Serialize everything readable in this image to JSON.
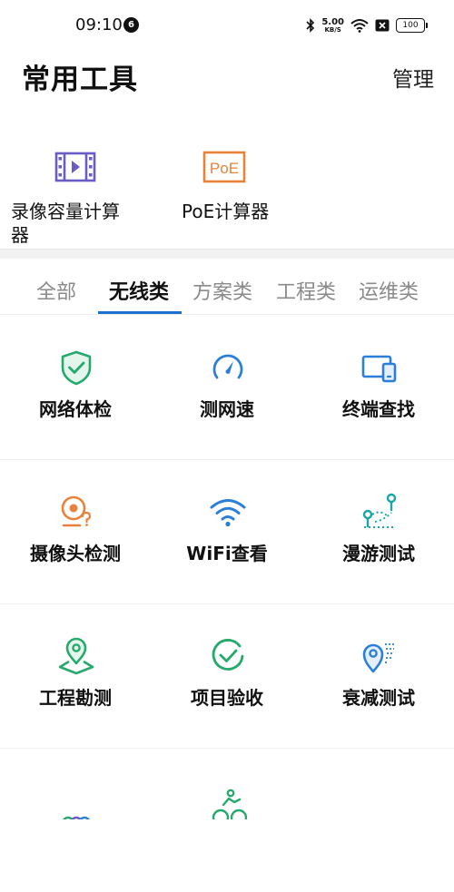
{
  "status_bar": {
    "time": "09:10",
    "notification_count": "6",
    "net_speed_value": "5.00",
    "net_speed_unit": "KB/S",
    "battery": "100"
  },
  "header": {
    "title": "常用工具",
    "manage_label": "管理"
  },
  "common_tools": [
    {
      "label": "录像容量计算器",
      "icon": "video-film-icon",
      "color": "#6b5bc4"
    },
    {
      "label": "PoE计算器",
      "icon": "poe-icon",
      "icon_text": "PoE",
      "color": "#e8823a"
    }
  ],
  "tabs": [
    {
      "label": "全部",
      "active": false
    },
    {
      "label": "无线类",
      "active": true
    },
    {
      "label": "方案类",
      "active": false
    },
    {
      "label": "工程类",
      "active": false
    },
    {
      "label": "运维类",
      "active": false
    }
  ],
  "accent_color": "#1b6fd1",
  "grid": [
    {
      "label": "网络体检",
      "icon": "shield-check-icon",
      "color": "#26a96c"
    },
    {
      "label": "测网速",
      "icon": "speedometer-icon",
      "color": "#2b7fd9"
    },
    {
      "label": "终端查找",
      "icon": "device-search-icon",
      "color": "#2b7fd9"
    },
    {
      "label": "摄像头检测",
      "icon": "camera-question-icon",
      "color": "#e8823a"
    },
    {
      "label": "WiFi查看",
      "icon": "wifi-icon",
      "color": "#2b7fd9"
    },
    {
      "label": "漫游测试",
      "icon": "roaming-icon",
      "color": "#1aa6a6"
    },
    {
      "label": "工程勘测",
      "icon": "map-pin-icon",
      "color": "#26a96c"
    },
    {
      "label": "项目验收",
      "icon": "check-circle-icon",
      "color": "#26a96c"
    },
    {
      "label": "衰减测试",
      "icon": "signal-decay-icon",
      "color": "#2b7fd9"
    },
    {
      "label": "",
      "icon": "rings-icon",
      "color": "#26a96c"
    },
    {
      "label": "",
      "icon": "cyclist-icon",
      "color": "#26a96c"
    }
  ]
}
